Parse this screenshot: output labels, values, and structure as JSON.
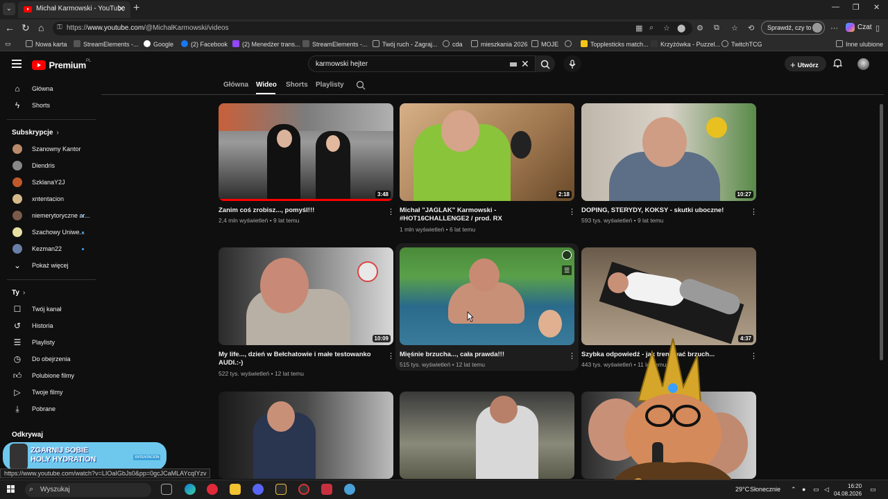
{
  "browser": {
    "tab_title": "Michał Karmowski - YouTube",
    "url_prefix": "https://",
    "url_domain": "www.youtube.com",
    "url_path": "/@MichałKarmowski/videos",
    "sprawdz_label": "Sprawdź, czy to Ty",
    "czat_label": "Czat",
    "bookmarks": [
      "Nowa karta",
      "StreamElements -...",
      "Google",
      "(2) Facebook",
      "(2) Menedżer trans...",
      "StreamElements -...",
      "Twój ruch - Zagraj...",
      "cda",
      "mieszkania 2026",
      "MOJE",
      "Topplesticks match...",
      "Krzyżówka - Puzzel...",
      "TwitchTCG"
    ],
    "other_bookmarks": "Inne ulubione"
  },
  "youtube": {
    "logo_text": "Premium",
    "logo_sup": "PL",
    "search_value": "karmowski hejter",
    "create_label": "Utwórz"
  },
  "sidebar": {
    "main": [
      {
        "label": "Główna",
        "icon": "home-icon"
      },
      {
        "label": "Shorts",
        "icon": "shorts-icon"
      }
    ],
    "subs_heading": "Subskrypcje",
    "subs": [
      {
        "label": "Szanowny Kantor",
        "dot": false,
        "color": "#b98a6a"
      },
      {
        "label": "Diendris",
        "dot": false,
        "color": "#888888"
      },
      {
        "label": "SzklanaY2J",
        "dot": false,
        "color": "#c0582b"
      },
      {
        "label": "xntentacion",
        "dot": false,
        "color": "#d6b98a"
      },
      {
        "label": "niemerytoryczne ar...",
        "dot": true,
        "color": "#7a5a4a"
      },
      {
        "label": "Szachowy Uniwe...",
        "dot": true,
        "color": "#e6e1a0"
      },
      {
        "label": "Kezman22",
        "dot": true,
        "color": "#6a7fa8"
      }
    ],
    "show_more": "Pokaż więcej",
    "you_heading": "Ty",
    "you_items": [
      {
        "label": "Twój kanał",
        "icon": "channel-icon"
      },
      {
        "label": "Historia",
        "icon": "history-icon"
      },
      {
        "label": "Playlisty",
        "icon": "playlists-icon"
      },
      {
        "label": "Do obejrzenia",
        "icon": "watch-later-icon"
      },
      {
        "label": "Polubione filmy",
        "icon": "liked-icon"
      },
      {
        "label": "Twoje filmy",
        "icon": "your-videos-icon"
      },
      {
        "label": "Pobrane",
        "icon": "downloads-icon"
      }
    ],
    "partial_heading": "Odkrywaj"
  },
  "channel_tabs": [
    "Główna",
    "Wideo",
    "Shorts",
    "Playlisty"
  ],
  "active_tab": "Wideo",
  "videos": [
    {
      "title": "Zanim coś zrobisz..., pomyśl!!!",
      "views": "2,4 mln wyświetleń",
      "age": "9 lat temu",
      "duration": "3:48",
      "watched": true
    },
    {
      "title": "Michał \"JAGLAK\" Karmowski - #HOT16CHALLENGE2 / prod. RX",
      "views": "1 mln wyświetleń",
      "age": "6 lat temu",
      "duration": "2:18",
      "watched": false
    },
    {
      "title": "DOPING, STERYDY, KOKSY - skutki uboczne!",
      "views": "593 tys. wyświetleń",
      "age": "9 lat temu",
      "duration": "10:27",
      "watched": false
    },
    {
      "title": "My life..., dzień w Bełchatowie i małe testowanko AUDI.:-)",
      "views": "522 tys. wyświetleń",
      "age": "12 lat temu",
      "duration": "10:09",
      "watched": false
    },
    {
      "title": "Mięśnie brzucha..., cała prawda!!!",
      "views": "515 tys. wyświetleń",
      "age": "12 lat temu",
      "duration": "",
      "watched": false
    },
    {
      "title": "Szybka odpowiedź - jak trenować brzuch...",
      "views": "443 tys. wyświetleń",
      "age": "11 lat temu",
      "duration": "4:37",
      "watched": false
    }
  ],
  "status_url": "https://www.youtube.com/watch?v=LIOaIGbJs0&pp=0gcJCaMLAYcqIYzv",
  "ad": {
    "line1": "ZGARNIJ SOBIE",
    "line2": "HOLY HYDRATION",
    "tag": "XNTENTACION"
  },
  "taskbar": {
    "search_label": "Wyszukaj",
    "weather_temp": "29°C",
    "weather_text": "Słonecznie",
    "time": "16:20",
    "date": "04.08.2026"
  }
}
